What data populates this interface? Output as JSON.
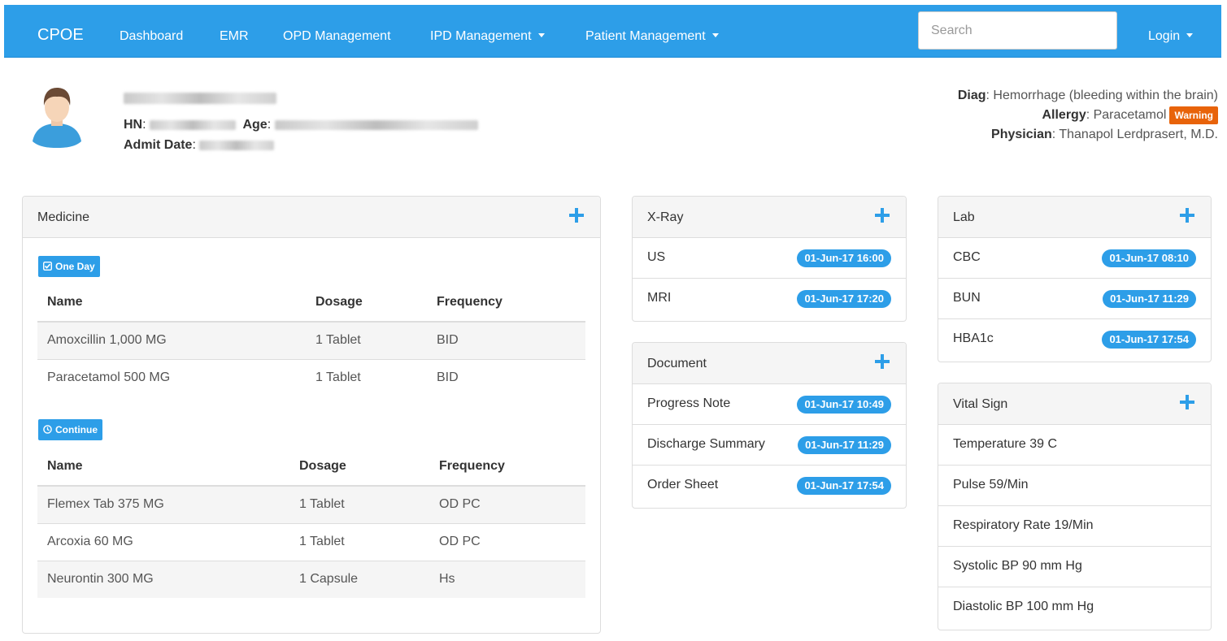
{
  "nav": {
    "brand": "CPOE",
    "links": [
      "Dashboard",
      "EMR",
      "OPD Management",
      "IPD Management",
      "Patient Management"
    ],
    "search_placeholder": "Search",
    "login": "Login"
  },
  "patient": {
    "hn_label": "HN",
    "age_label": "Age",
    "admit_label": "Admit Date",
    "diag_label": "Diag",
    "diag_value": "Hemorrhage (bleeding within the brain)",
    "allergy_label": "Allergy",
    "allergy_value": "Paracetamol",
    "warning_badge": "Warning",
    "physician_label": "Physician",
    "physician_value": "Thanapol Lerdprasert, M.D."
  },
  "medicine": {
    "title": "Medicine",
    "one_day_label": "One Day",
    "continue_label": "Continue",
    "headers": [
      "Name",
      "Dosage",
      "Frequency"
    ],
    "one_day": [
      {
        "name": "Amoxcillin 1,000 MG",
        "dosage": "1 Tablet",
        "frequency": "BID"
      },
      {
        "name": "Paracetamol 500 MG",
        "dosage": "1 Tablet",
        "frequency": "BID"
      }
    ],
    "continue": [
      {
        "name": "Flemex Tab 375 MG",
        "dosage": "1 Tablet",
        "frequency": "OD PC"
      },
      {
        "name": "Arcoxia 60 MG",
        "dosage": "1 Tablet",
        "frequency": "OD PC"
      },
      {
        "name": "Neurontin 300 MG",
        "dosage": "1 Capsule",
        "frequency": "Hs"
      }
    ]
  },
  "xray": {
    "title": "X-Ray",
    "items": [
      {
        "label": "US",
        "date": "01-Jun-17 16:00"
      },
      {
        "label": "MRI",
        "date": "01-Jun-17 17:20"
      }
    ]
  },
  "document": {
    "title": "Document",
    "items": [
      {
        "label": "Progress Note",
        "date": "01-Jun-17 10:49"
      },
      {
        "label": "Discharge Summary",
        "date": "01-Jun-17 11:29"
      },
      {
        "label": "Order Sheet",
        "date": "01-Jun-17 17:54"
      }
    ]
  },
  "lab": {
    "title": "Lab",
    "items": [
      {
        "label": "CBC",
        "date": "01-Jun-17 08:10"
      },
      {
        "label": "BUN",
        "date": "01-Jun-17 11:29"
      },
      {
        "label": "HBA1c",
        "date": "01-Jun-17 17:54"
      }
    ]
  },
  "vital": {
    "title": "Vital Sign",
    "items": [
      "Temperature 39 C",
      "Pulse 59/Min",
      "Respiratory Rate 19/Min",
      "Systolic BP 90 mm Hg",
      "Diastolic BP 100 mm Hg"
    ]
  },
  "icons": {
    "plus": "plus-icon",
    "check": "check-square-icon",
    "clock": "clock-icon",
    "avatar": "user-avatar"
  },
  "colors": {
    "primary": "#2d9ee8",
    "warning": "#e8630a"
  }
}
